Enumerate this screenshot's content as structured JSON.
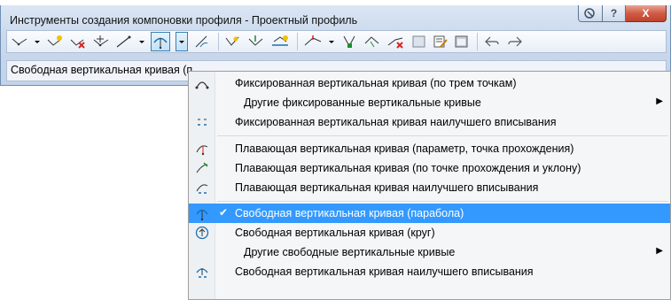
{
  "window": {
    "title": "Инструменты создания компоновки профиля - Проектный профиль",
    "buttons": {
      "help": "?",
      "close": "X"
    }
  },
  "toolbar": {
    "icons": [
      "draw-tangents-icon",
      "dropdown-arrow",
      "insert-pvi-icon",
      "delete-pvi-icon",
      "move-pvi-icon",
      "fixed-tangent-icon",
      "dropdown-arrow",
      "free-vertical-curve-icon",
      "dropdown-arrow",
      "convert-icon",
      "insert-pvis-tabular-icon",
      "lower-raise-pvis-icon",
      "copy-profile-icon",
      "profile-offset-icon",
      "dropdown-arrow",
      "select-pvi-icon",
      "delete-entity-icon",
      "break-apart-icon",
      "grid-view-icon",
      "properties-icon",
      "table-view-icon",
      "undo-icon",
      "redo-icon"
    ]
  },
  "rowbar": {
    "label": "Свободная вертикальная кривая (парабола)"
  },
  "menu": {
    "items": [
      {
        "label": "Фиксированная вертикальная кривая (по трем точкам)",
        "icon": "fixed-curve-three-points-icon"
      },
      {
        "label": "Другие фиксированные вертикальные кривые",
        "icon": "",
        "submenu": true
      },
      {
        "label": "Фиксированная вертикальная кривая наилучшего вписывания",
        "icon": "fixed-curve-best-fit-icon"
      },
      {
        "label": "Плавающая вертикальная кривая (параметр, точка прохождения)",
        "icon": "floating-curve-parameter-icon"
      },
      {
        "label": "Плавающая вертикальная кривая (по точке прохождения и уклону)",
        "icon": "floating-curve-grade-icon"
      },
      {
        "label": "Плавающая вертикальная кривая наилучшего вписывания",
        "icon": "floating-curve-best-fit-icon"
      },
      {
        "label": "Свободная вертикальная кривая (парабола)",
        "icon": "free-curve-parabola-icon",
        "checked": true
      },
      {
        "label": "Свободная вертикальная кривая (круг)",
        "icon": "free-curve-circle-icon"
      },
      {
        "label": "Другие свободные вертикальные кривые",
        "icon": "",
        "submenu": true
      },
      {
        "label": "Свободная вертикальная кривая наилучшего вписывания",
        "icon": "free-curve-best-fit-icon"
      }
    ],
    "check_mark": "✔",
    "submenu_arrow": "▶"
  },
  "colors": {
    "highlight": "#3399ff",
    "close_button": "#c2412b"
  }
}
